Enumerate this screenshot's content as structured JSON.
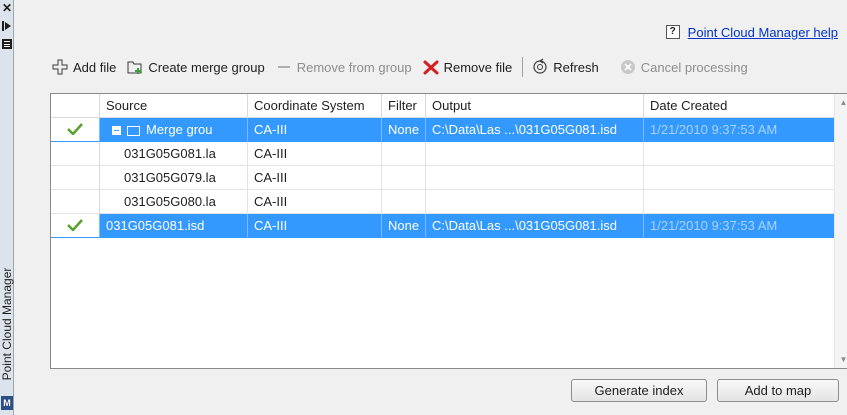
{
  "side_panel": {
    "title": "Point Cloud Manager",
    "icons": [
      "close-icon",
      "auto-hide-icon",
      "properties-icon",
      "map-3d-icon"
    ],
    "map_icon_text": "M"
  },
  "help": {
    "icon_text": "?",
    "link_text": "Point Cloud Manager help"
  },
  "toolbar": {
    "add_file": "Add file",
    "create_merge_group": "Create merge group",
    "remove_from_group": "Remove from group",
    "remove_file": "Remove file",
    "refresh": "Refresh",
    "cancel_processing": "Cancel processing"
  },
  "grid": {
    "columns": [
      "",
      "Source",
      "Coordinate System",
      "Filter",
      "Output",
      "Date Created"
    ],
    "rows": [
      {
        "checked": true,
        "selected": true,
        "group": true,
        "source": "Merge grou",
        "cs": "CA-III",
        "filter": "None",
        "output": "C:\\Data\\Las ...\\031G05G081.isd",
        "date": "1/21/2010 9:37:53 AM"
      },
      {
        "checked": false,
        "selected": false,
        "group": false,
        "child": true,
        "source": "031G05G081.la",
        "cs": "CA-III",
        "filter": "",
        "output": "",
        "date": ""
      },
      {
        "checked": false,
        "selected": false,
        "group": false,
        "child": true,
        "source": "031G05G079.la",
        "cs": "CA-III",
        "filter": "",
        "output": "",
        "date": ""
      },
      {
        "checked": false,
        "selected": false,
        "group": false,
        "child": true,
        "source": "031G05G080.la",
        "cs": "CA-III",
        "filter": "",
        "output": "",
        "date": ""
      },
      {
        "checked": true,
        "selected": true,
        "group": false,
        "source": "031G05G081.isd",
        "cs": "CA-III",
        "filter": "None",
        "output": "C:\\Data\\Las ...\\031G05G081.isd",
        "date": "1/21/2010 9:37:53 AM"
      }
    ]
  },
  "buttons": {
    "generate_index": "Generate index",
    "add_to_map": "Add to map"
  },
  "colors": {
    "selection": "#3399ff",
    "check": "#5aa02c",
    "remove": "#d42020",
    "link": "#0033cc"
  }
}
